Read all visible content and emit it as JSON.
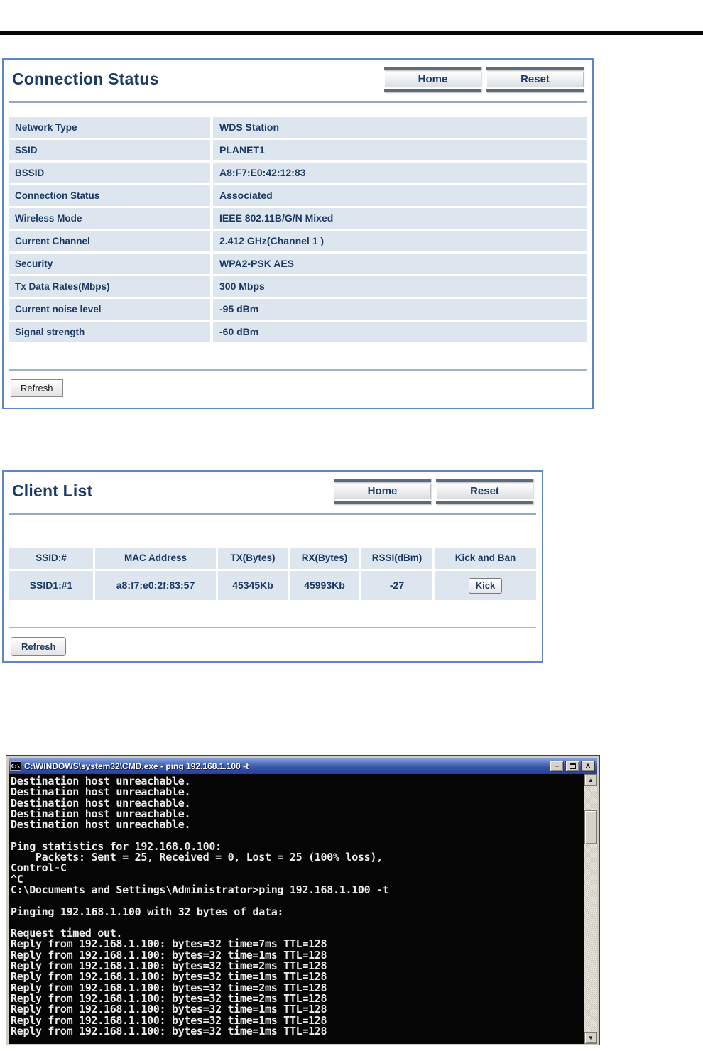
{
  "connection_status": {
    "title": "Connection Status",
    "buttons": {
      "home": "Home",
      "reset": "Reset",
      "refresh": "Refresh"
    },
    "rows": [
      {
        "label": "Network Type",
        "value": "WDS Station"
      },
      {
        "label": "SSID",
        "value": "PLANET1"
      },
      {
        "label": "BSSID",
        "value": "A8:F7:E0:42:12:83"
      },
      {
        "label": "Connection Status",
        "value": "Associated"
      },
      {
        "label": "Wireless Mode",
        "value": "IEEE 802.11B/G/N Mixed"
      },
      {
        "label": "Current Channel",
        "value": "2.412 GHz(Channel 1 )"
      },
      {
        "label": "Security",
        "value": "WPA2-PSK AES"
      },
      {
        "label": "Tx Data Rates(Mbps)",
        "value": "300 Mbps"
      },
      {
        "label": "Current noise level",
        "value": "-95 dBm"
      },
      {
        "label": "Signal strength",
        "value": "-60 dBm"
      }
    ]
  },
  "client_list": {
    "title": "Client List",
    "buttons": {
      "home": "Home",
      "reset": "Reset",
      "refresh": "Refresh"
    },
    "columns": [
      "SSID:#",
      "MAC Address",
      "TX(Bytes)",
      "RX(Bytes)",
      "RSSI(dBm)",
      "Kick and Ban"
    ],
    "clients": [
      {
        "ssid": "SSID1:#1",
        "mac": "a8:f7:e0:2f:83:57",
        "tx": "45345Kb",
        "rx": "45993Kb",
        "rssi": "-27",
        "action": "Kick"
      }
    ]
  },
  "terminal": {
    "icon_label": "C:\\",
    "title": "C:\\WINDOWS\\system32\\CMD.exe - ping 192.168.1.100 -t",
    "window_buttons": {
      "minimize": "_",
      "close": "X"
    },
    "scroll_icons": {
      "up": "▲",
      "down": "▼"
    },
    "lines": [
      "Destination host unreachable.",
      "Destination host unreachable.",
      "Destination host unreachable.",
      "Destination host unreachable.",
      "Destination host unreachable.",
      "",
      "Ping statistics for 192.168.0.100:",
      "    Packets: Sent = 25, Received = 0, Lost = 25 (100% loss),",
      "Control-C",
      "^C",
      "C:\\Documents and Settings\\Administrator>ping 192.168.1.100 -t",
      "",
      "Pinging 192.168.1.100 with 32 bytes of data:",
      "",
      "Request timed out.",
      "Reply from 192.168.1.100: bytes=32 time=7ms TTL=128",
      "Reply from 192.168.1.100: bytes=32 time=1ms TTL=128",
      "Reply from 192.168.1.100: bytes=32 time=2ms TTL=128",
      "Reply from 192.168.1.100: bytes=32 time=1ms TTL=128",
      "Reply from 192.168.1.100: bytes=32 time=2ms TTL=128",
      "Reply from 192.168.1.100: bytes=32 time=2ms TTL=128",
      "Reply from 192.168.1.100: bytes=32 time=1ms TTL=128",
      "Reply from 192.168.1.100: bytes=32 time=1ms TTL=128",
      "Reply from 192.168.1.100: bytes=32 time=1ms TTL=128"
    ]
  },
  "colors": {
    "accent_navy": "#1b3a66",
    "panel_border": "#5b87c5",
    "cell_bg": "#dde6ee",
    "header_bar_gray": "#5d6c7b",
    "titlebar_blue": "#24409b",
    "terminal_bg": "#050505"
  }
}
